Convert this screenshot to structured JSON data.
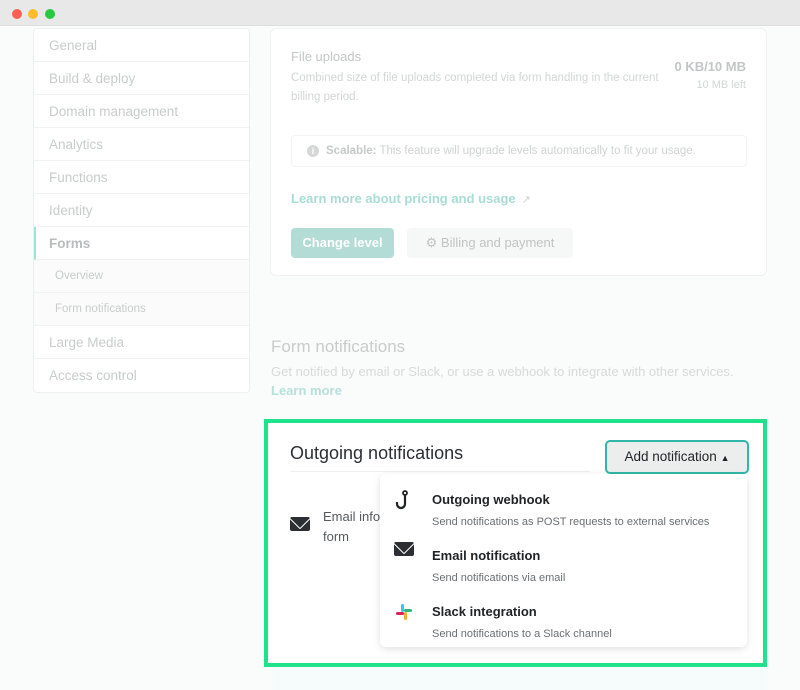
{
  "window": {
    "controls": [
      {
        "name": "close",
        "color": "#fe5f57"
      },
      {
        "name": "minimize",
        "color": "#febc2e"
      },
      {
        "name": "maximize",
        "color": "#28c840"
      }
    ]
  },
  "sidebar": {
    "items": [
      {
        "label": "General"
      },
      {
        "label": "Build & deploy"
      },
      {
        "label": "Domain management"
      },
      {
        "label": "Analytics"
      },
      {
        "label": "Functions"
      },
      {
        "label": "Identity"
      },
      {
        "label": "Forms",
        "active": true
      },
      {
        "label": "Overview",
        "sub": true
      },
      {
        "label": "Form notifications",
        "sub": true
      },
      {
        "label": "Large Media"
      },
      {
        "label": "Access control"
      }
    ]
  },
  "usage": {
    "title": "File uploads",
    "description": "Combined size of file uploads completed via form handling in the current billing period.",
    "value": "0 KB/10 MB",
    "remaining": "10 MB left",
    "info_label": "Scalable:",
    "info_text": " This feature will upgrade levels automatically to fit your usage.",
    "learn_more": "Learn more about pricing and usage",
    "change_level": "Change level",
    "billing": "Billing and payment"
  },
  "form_notifications": {
    "title": "Form notifications",
    "description": "Get notified by email or Slack, or use a webhook to integrate with other services.",
    "learn_more": "Learn more"
  },
  "outgoing": {
    "title": "Outgoing notifications",
    "add_button": "Add notification",
    "email_row_text": "Email info",
    "email_row_text2": "form",
    "menu": [
      {
        "icon": "hook-icon",
        "title": "Outgoing webhook",
        "desc": "Send notifications as POST requests to external services"
      },
      {
        "icon": "envelope-icon",
        "title": "Email notification",
        "desc": "Send notifications via email"
      },
      {
        "icon": "slack-icon",
        "title": "Slack integration",
        "desc": "Send notifications to a Slack channel"
      }
    ]
  },
  "colors": {
    "accent": "#2fb8a8",
    "highlight": "#1ee38a"
  }
}
